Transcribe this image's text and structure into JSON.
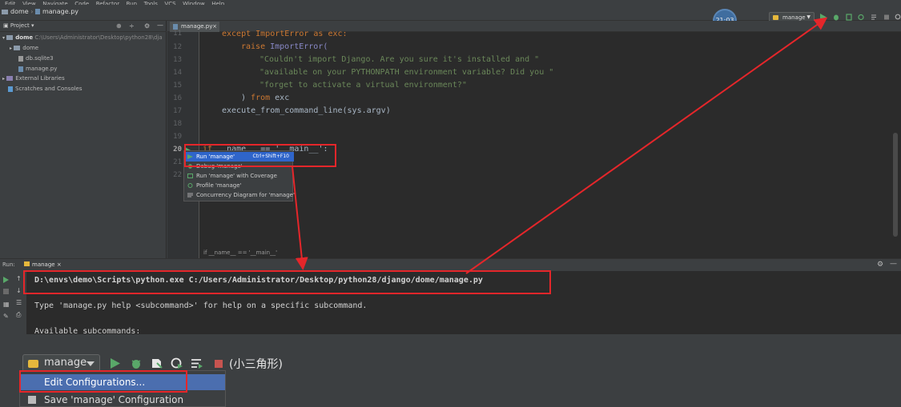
{
  "menu": {
    "items": [
      "Edit",
      "View",
      "Navigate",
      "Code",
      "Refactor",
      "Run",
      "Tools",
      "VCS",
      "Window",
      "Help"
    ]
  },
  "navbar": {
    "project": "dome",
    "file": "manage.py"
  },
  "clock": "21:03",
  "run_config": {
    "label": "manage"
  },
  "project_panel": {
    "title": "Project",
    "tree": [
      {
        "label": "dome",
        "path": "C:\\Users\\Administrator\\Desktop\\python28\\dja"
      },
      {
        "label": "dome"
      },
      {
        "label": "db.sqlite3"
      },
      {
        "label": "manage.py"
      },
      {
        "label": "External Libraries"
      },
      {
        "label": "Scratches and Consoles"
      }
    ]
  },
  "editor": {
    "tab": "manage.py",
    "line_numbers": [
      "11",
      "12",
      "13",
      "14",
      "15",
      "16",
      "17",
      "18",
      "19",
      "20",
      "21",
      "22"
    ],
    "code": {
      "l11a": "except ",
      "l11b": "ImportError",
      "l11c": " as exc:",
      "l12a": "raise ",
      "l12b": "ImportError(",
      "l13": "\"Couldn't import Django. Are you sure it's installed and \"",
      "l14": "\"available on your PYTHONPATH environment variable? Did you \"",
      "l15": "\"forget to activate a virtual environment?\"",
      "l16a": ") ",
      "l16b": "from",
      "l16c": " exc",
      "l17": "execute_from_command_line(sys.argv)",
      "l20a": "if ",
      "l20b": "__name__ == '__main__':"
    },
    "breadcrumb": "if __name__ == '__main__'"
  },
  "context_menu": {
    "items": [
      {
        "label": "Run 'manage'",
        "shortcut": "Ctrl+Shift+F10"
      },
      {
        "label": "Debug 'manage'"
      },
      {
        "label": "Run 'manage' with Coverage"
      },
      {
        "label": "Profile 'manage'"
      },
      {
        "label": "Concurrency Diagram for 'manage'"
      }
    ]
  },
  "run_panel": {
    "label": "Run:",
    "tab": "manage",
    "lines": [
      "D:\\envs\\demo\\Scripts\\python.exe C:/Users/Administrator/Desktop/python28/django/dome/manage.py",
      "Type 'manage.py help <subcommand>' for help on a specific subcommand.",
      "Available subcommands:"
    ]
  },
  "overlay": {
    "combo_label": "manage",
    "note": "(小三角形)",
    "dropdown": [
      "Edit Configurations...",
      "Save 'manage' Configuration"
    ]
  },
  "colors": {
    "accent": "#2f65ca",
    "annotation": "#e5262a",
    "run_green": "#59a869"
  }
}
